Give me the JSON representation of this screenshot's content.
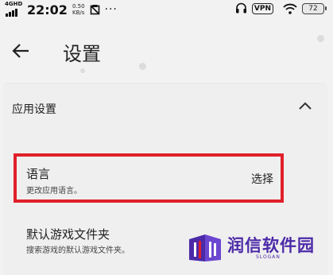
{
  "status_bar": {
    "network": "4GHD",
    "time": "22:02",
    "speed_value": "0.50",
    "speed_unit": "KB/s",
    "vpn": "VPN",
    "battery": "72"
  },
  "header": {
    "title": "设置"
  },
  "section": {
    "title": "应用设置"
  },
  "preferences": [
    {
      "title": "语言",
      "summary": "更改应用语言。",
      "value": "选择"
    },
    {
      "title": "默认游戏文件夹",
      "summary": "搜索游戏的默认游戏文件夹。"
    }
  ],
  "watermark": {
    "text": "润信软件园",
    "slogan": "SLOGAN"
  },
  "colors": {
    "highlight": "#e0202a",
    "watermark": "#4b2aa8"
  }
}
